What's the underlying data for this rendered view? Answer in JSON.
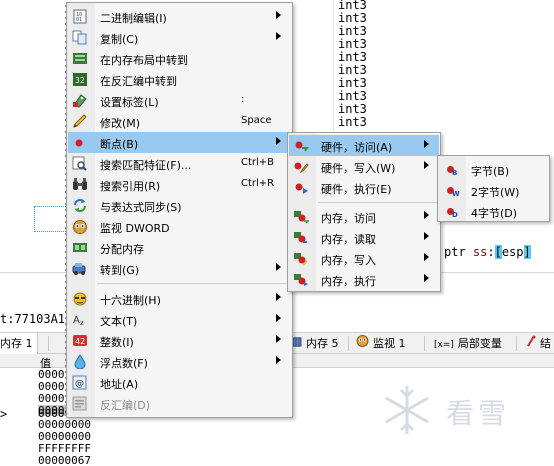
{
  "background": {
    "int3_text": "int3",
    "disasm_ptr": {
      "prefix": "ptr ",
      "seg": "ss",
      "colon": ":",
      "open": "[",
      "reg": "esp",
      "close": "]"
    },
    "address_label": "t:77103A1",
    "dump_header": "值",
    "dump_arrow": ">",
    "dump_values": [
      "0000",
      "0000",
      "0000",
      "0000",
      "00000001",
      "00000000",
      "00000000",
      "FFFFFFFF",
      "00000067"
    ],
    "tabs": [
      {
        "label": "内存 1"
      },
      {
        "label": "内存 5"
      },
      {
        "label": "监视 1"
      },
      {
        "label": "局部变量"
      },
      {
        "label": "结"
      }
    ],
    "tab_icon_locals": "[x=]",
    "watermark": "看雪"
  },
  "main_menu": {
    "items": [
      {
        "label": "二进制编辑(I)",
        "shortcut": "",
        "submenu": true,
        "icon": "binary-edit-icon"
      },
      {
        "label": "复制(C)",
        "shortcut": "",
        "submenu": true,
        "icon": "copy-icon"
      },
      {
        "label": "在内存布局中转到",
        "shortcut": "",
        "submenu": false,
        "icon": "memory-map-icon"
      },
      {
        "label": "在反汇编中转到",
        "shortcut": "",
        "submenu": false,
        "icon": "disasm-icon"
      },
      {
        "label": "设置标签(L)",
        "shortcut": ":",
        "submenu": false,
        "icon": "label-icon"
      },
      {
        "label": "修改(M)",
        "shortcut": "Space",
        "submenu": false,
        "icon": "pencil-icon"
      },
      {
        "label": "断点(B)",
        "shortcut": "",
        "submenu": true,
        "icon": "breakpoint-icon"
      },
      {
        "label": "搜索匹配特征(F)...",
        "shortcut": "Ctrl+B",
        "submenu": false,
        "icon": "search-pattern-icon"
      },
      {
        "label": "搜索引用(R)",
        "shortcut": "Ctrl+R",
        "submenu": false,
        "icon": "binoculars-icon"
      },
      {
        "label": "与表达式同步(S)",
        "shortcut": "",
        "submenu": false,
        "icon": "sync-icon"
      },
      {
        "label": "监视 DWORD",
        "shortcut": "",
        "submenu": false,
        "icon": "watch-icon"
      },
      {
        "label": "分配内存",
        "shortcut": "",
        "submenu": false,
        "icon": "alloc-icon"
      },
      {
        "label": "转到(G)",
        "shortcut": "",
        "submenu": true,
        "icon": "goto-icon"
      },
      {
        "label": "十六进制(H)",
        "shortcut": "",
        "submenu": true,
        "icon": "hex-icon"
      },
      {
        "label": "文本(T)",
        "shortcut": "",
        "submenu": true,
        "icon": "text-icon"
      },
      {
        "label": "整数(I)",
        "shortcut": "",
        "submenu": true,
        "icon": "integer-icon"
      },
      {
        "label": "浮点数(F)",
        "shortcut": "",
        "submenu": true,
        "icon": "float-icon"
      },
      {
        "label": "地址(A)",
        "shortcut": "",
        "submenu": false,
        "icon": "address-icon"
      },
      {
        "label": "反汇编(D)",
        "shortcut": "",
        "submenu": false,
        "icon": "disasm-view-icon",
        "disabled": true
      }
    ],
    "int3_dummy": ""
  },
  "bp_menu": {
    "items": [
      {
        "label": "硬件，访问(A)",
        "submenu": true
      },
      {
        "label": "硬件，写入(W)",
        "submenu": true
      },
      {
        "label": "硬件，执行(E)",
        "submenu": false
      },
      {
        "label": "内存，访问",
        "submenu": true
      },
      {
        "label": "内存，读取",
        "submenu": true
      },
      {
        "label": "内存，写入",
        "submenu": true
      },
      {
        "label": "内存，执行",
        "submenu": true
      }
    ]
  },
  "size_menu": {
    "items": [
      {
        "label": "字节(B)",
        "badge": "B"
      },
      {
        "label": "2字节(W)",
        "badge": "W"
      },
      {
        "label": "4字节(D)",
        "badge": "D"
      }
    ]
  },
  "colors": {
    "highlight": "#99c9ef",
    "menu_bg": "#f5f5f5",
    "breakpoint_red": "#d02020"
  }
}
